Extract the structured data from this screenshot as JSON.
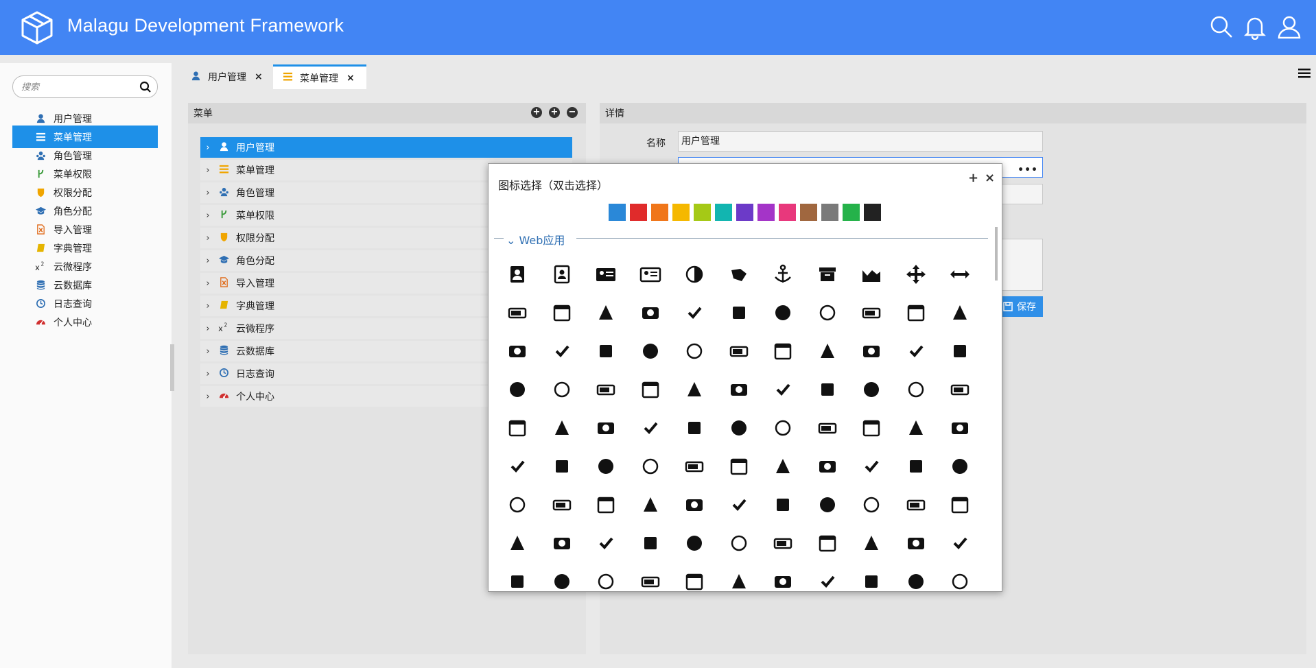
{
  "app": {
    "title": "Malagu Development Framework"
  },
  "header_icons": [
    "search-icon",
    "bell-icon",
    "user-icon"
  ],
  "sidebar": {
    "search_placeholder": "搜索",
    "items": [
      {
        "label": "用户管理",
        "icon": "user-icon",
        "color": "#2f6fb3"
      },
      {
        "label": "菜单管理",
        "icon": "list-icon",
        "color": "#ffffff",
        "active": true
      },
      {
        "label": "角色管理",
        "icon": "users-icon",
        "color": "#2f6fb3"
      },
      {
        "label": "菜单权限",
        "icon": "code-fork-icon",
        "color": "#3a9a3a"
      },
      {
        "label": "权限分配",
        "icon": "shield-icon",
        "color": "#f0a500"
      },
      {
        "label": "角色分配",
        "icon": "graduation-cap-icon",
        "color": "#2f6fb3"
      },
      {
        "label": "导入管理",
        "icon": "file-excel-icon",
        "color": "#e06b1a"
      },
      {
        "label": "字典管理",
        "icon": "book-icon",
        "color": "#e5b400"
      },
      {
        "label": "云微程序",
        "icon": "superscript-icon",
        "color": "#222222"
      },
      {
        "label": "云数据库",
        "icon": "database-icon",
        "color": "#2f6fb3"
      },
      {
        "label": "日志查询",
        "icon": "clock-icon",
        "color": "#2f6fb3"
      },
      {
        "label": "个人中心",
        "icon": "dashboard-icon",
        "color": "#d03030"
      }
    ]
  },
  "tabs": [
    {
      "label": "用户管理",
      "icon": "user-icon",
      "color": "#2f6fb3",
      "close": "×"
    },
    {
      "label": "菜单管理",
      "icon": "list-icon",
      "color": "#f0a500",
      "close": "×",
      "active": true
    }
  ],
  "menu_panel": {
    "title": "菜单",
    "tools": [
      "+",
      "+",
      "−"
    ],
    "rows": [
      {
        "label": "用户管理",
        "icon": "user-icon",
        "color": "#ffffff",
        "active": true
      },
      {
        "label": "菜单管理",
        "icon": "list-icon",
        "color": "#f0a500"
      },
      {
        "label": "角色管理",
        "icon": "users-icon",
        "color": "#2f6fb3"
      },
      {
        "label": "菜单权限",
        "icon": "code-fork-icon",
        "color": "#3a9a3a"
      },
      {
        "label": "权限分配",
        "icon": "shield-icon",
        "color": "#f0a500"
      },
      {
        "label": "角色分配",
        "icon": "graduation-cap-icon",
        "color": "#2f6fb3"
      },
      {
        "label": "导入管理",
        "icon": "file-excel-icon",
        "color": "#e06b1a"
      },
      {
        "label": "字典管理",
        "icon": "book-icon",
        "color": "#e5b400"
      },
      {
        "label": "云微程序",
        "icon": "superscript-icon",
        "color": "#222222"
      },
      {
        "label": "云数据库",
        "icon": "database-icon",
        "color": "#2f6fb3"
      },
      {
        "label": "日志查询",
        "icon": "clock-icon",
        "color": "#2f6fb3"
      },
      {
        "label": "个人中心",
        "icon": "dashboard-icon",
        "color": "#d03030"
      }
    ]
  },
  "detail_panel": {
    "title": "详情",
    "name_label": "名称",
    "name_value": "用户管理",
    "icon_value": "",
    "icon_button": "•••",
    "save_label": "保存"
  },
  "icon_dialog": {
    "title": "图标选择（双击选择）",
    "add": "+",
    "close": "×",
    "colors": [
      "#2a88d8",
      "#e02b2b",
      "#f0761a",
      "#f5b800",
      "#a5c916",
      "#12b5b0",
      "#6c3ac8",
      "#a434c8",
      "#e8387c",
      "#a0673f",
      "#7a7a7a",
      "#25b24a",
      "#222222"
    ],
    "section_label": "Web应用",
    "icons": [
      "address-book-icon",
      "address-book-o-icon",
      "address-card-icon",
      "address-card-o-icon",
      "adjust-icon",
      "american-sign-language-icon",
      "anchor-icon",
      "archive-icon",
      "area-chart-icon",
      "arrows-icon",
      "arrows-h-icon",
      "arrows-v-icon",
      "asl-interpreting-icon",
      "assistive-listening-icon",
      "asterisk-icon",
      "at-icon",
      "audio-description-icon",
      "automobile-icon",
      "balance-scale-icon",
      "ban-icon",
      "bank-icon",
      "bar-chart-icon",
      "bar-chart-o-icon",
      "barcode-icon",
      "bars-icon",
      "bath-icon",
      "bathtub-icon",
      "battery-full-icon",
      "battery-empty-icon",
      "battery-quarter-icon",
      "battery-half-icon",
      "battery-three-quarters-icon",
      "battery-4-icon",
      "battery-0-icon",
      "battery-full-2-icon",
      "battery-1-icon",
      "battery-1b-icon",
      "battery-2-icon",
      "bed-icon",
      "beer-icon",
      "bell-icon",
      "bell-o-icon",
      "bell-slash-icon",
      "bell-slash-o-icon",
      "bicycle-icon",
      "binoculars-icon",
      "birthday-cake-icon",
      "blind-icon",
      "bluetooth-icon",
      "bluetooth-b-icon",
      "bolt-icon",
      "bomb-icon",
      "book-icon",
      "bookmark-icon",
      "bookmark-o-icon",
      "braille-icon",
      "briefcase-icon",
      "bug-icon",
      "building-icon",
      "building-o-icon",
      "bullhorn-icon",
      "bullseye-icon",
      "bus-icon",
      "cab-icon",
      "calculator-icon",
      "calendar-icon",
      "calendar-check-icon",
      "calendar-minus-icon",
      "calendar-o-icon",
      "calendar-plus-icon",
      "calendar-times-icon",
      "camera-icon",
      "camera-retro-icon",
      "car-icon",
      "caret-square-down-icon",
      "caret-square-left-icon",
      "caret-square-right-icon",
      "caret-square-up-icon",
      "cart-arrow-down-icon",
      "cart-plus-icon",
      "cc-icon",
      "certificate-icon",
      "check-icon",
      "check-circle-icon",
      "check-circle-o-icon",
      "check-square-icon",
      "check-square-o-icon",
      "child-icon",
      "circle-icon",
      "circle-o-icon",
      "circle-o-notch-icon",
      "circle-thin-icon",
      "clock-icon",
      "clone-icon",
      "close-icon",
      "cloud-icon",
      "cloud-download-icon",
      "cloud-upload-icon",
      "code-icon"
    ]
  }
}
